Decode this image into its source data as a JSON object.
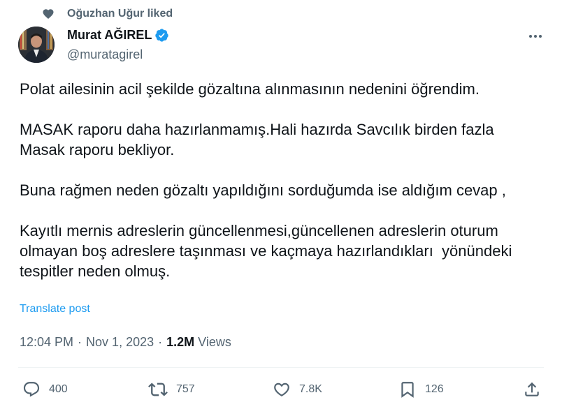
{
  "social_context": {
    "text": "Oğuzhan Uğur liked",
    "icon": "heart-icon"
  },
  "author": {
    "name": "Murat AĞIREL",
    "handle": "@muratagirel",
    "verified": true,
    "verified_color": "#1d9bf0"
  },
  "tweet": {
    "paragraphs": [
      "Polat ailesinin acil şekilde gözaltına alınmasının nedenini öğrendim.",
      "MASAK raporu daha hazırlanmamış.Hali hazırda Savcılık birden fazla\nMasak raporu bekliyor.",
      "Buna rağmen neden gözaltı yapıldığını sorduğumda ise aldığım cevap ,",
      "Kayıtlı mernis adreslerin güncellenmesi,güncellenen adreslerin oturum\nolmayan boş adreslere taşınması ve kaçmaya hazırlandıkları  yönündeki\ntespitler neden olmuş."
    ],
    "translate_label": "Translate post"
  },
  "meta": {
    "time": "12:04 PM",
    "separator": "·",
    "date": "Nov 1, 2023",
    "views_count": "1.2M",
    "views_label": "Views"
  },
  "actions": {
    "replies": "400",
    "reposts": "757",
    "likes": "7.8K",
    "bookmarks": "126"
  },
  "colors": {
    "text": "#0f1419",
    "secondary": "#536471",
    "link": "#1d9bf0",
    "divider": "#eff3f4"
  }
}
